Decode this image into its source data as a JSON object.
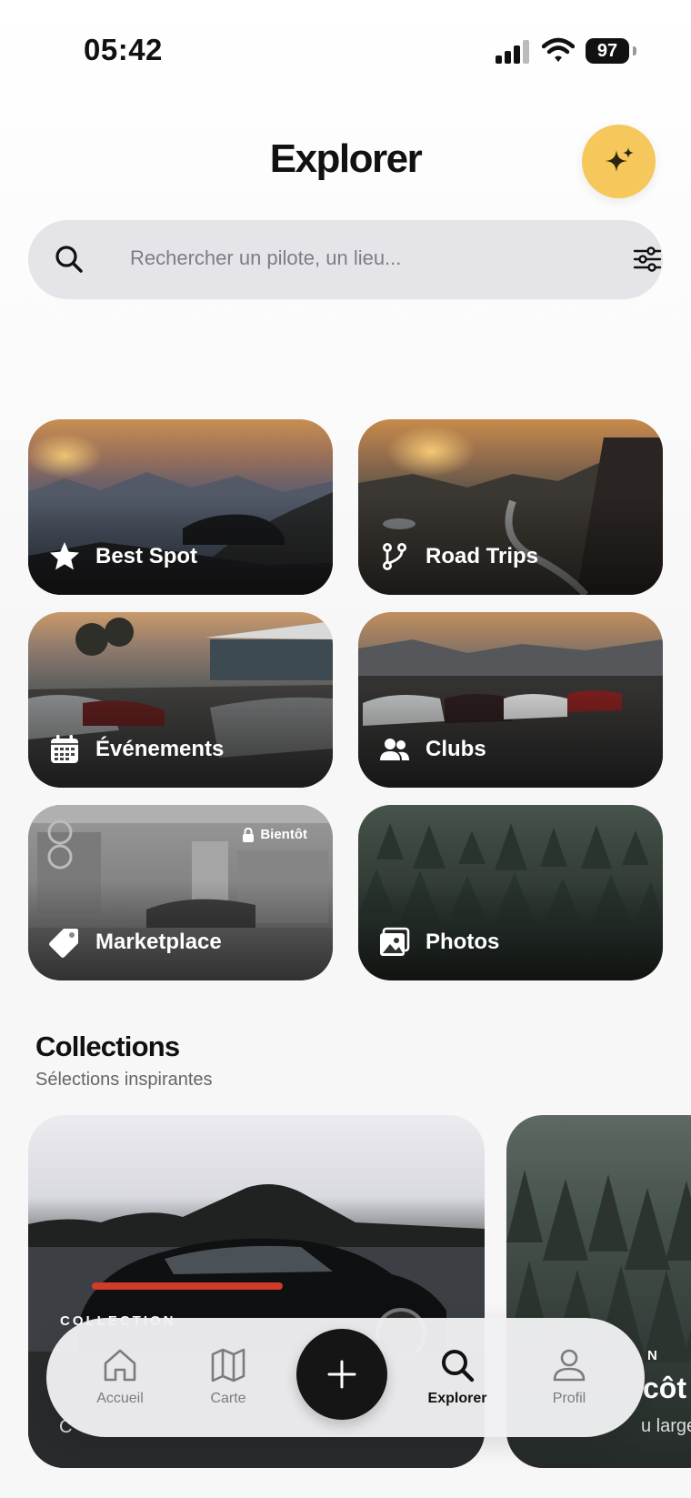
{
  "status_bar": {
    "time": "05:42",
    "battery": "97"
  },
  "header": {
    "title": "Explorer"
  },
  "search": {
    "placeholder": "Rechercher un pilote, un lieu..."
  },
  "categories": [
    {
      "label": "Best Spot",
      "icon": "star-icon"
    },
    {
      "label": "Road Trips",
      "icon": "route-icon"
    },
    {
      "label": "Événements",
      "icon": "calendar-icon"
    },
    {
      "label": "Clubs",
      "icon": "people-icon"
    },
    {
      "label": "Marketplace",
      "icon": "tag-icon",
      "badge": "Bientôt"
    },
    {
      "label": "Photos",
      "icon": "photos-icon"
    }
  ],
  "collections": {
    "title": "Collections",
    "subtitle": "Sélections inspirantes",
    "cards": [
      {
        "kicker": "COLLECTION",
        "subtitle": "C"
      },
      {
        "kicker": "N",
        "title": "côt",
        "subtitle": "u large"
      }
    ]
  },
  "tabbar": {
    "items": [
      {
        "label": "Accueil",
        "icon": "home-icon"
      },
      {
        "label": "Carte",
        "icon": "map-icon"
      },
      {
        "label": "Explorer",
        "icon": "search-icon",
        "active": true
      },
      {
        "label": "Profil",
        "icon": "profile-icon"
      }
    ]
  }
}
